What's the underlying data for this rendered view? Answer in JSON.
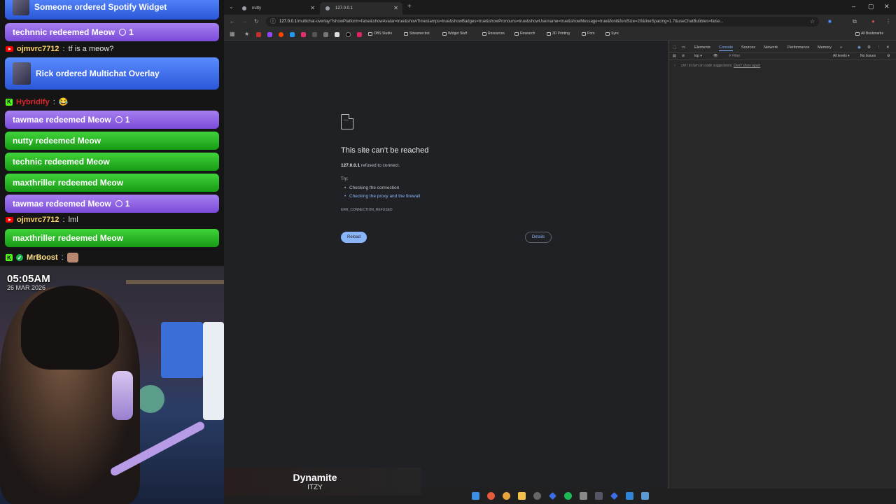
{
  "overlay": {
    "events": [
      {
        "type": "order",
        "text": "Someone ordered Spotify Widget"
      },
      {
        "type": "redeem",
        "user": "technnic",
        "action": "redeemed",
        "reward": "Meow",
        "count": "1"
      },
      {
        "type": "chat",
        "platform": "youtube",
        "user": "ojmvrc7712",
        "message": "tf is a meow?"
      },
      {
        "type": "order",
        "text": "Rick ordered Multichat Overlay"
      },
      {
        "type": "chat",
        "platform": "kick",
        "user": "Hybridlfy",
        "message": "😂"
      },
      {
        "type": "redeem",
        "user": "tawmae",
        "action": "redeemed",
        "reward": "Meow",
        "count": "1"
      },
      {
        "type": "redeem",
        "user": "nutty",
        "action": "redeemed",
        "reward": "Meow",
        "count": ""
      },
      {
        "type": "redeem",
        "user": "technic",
        "action": "redeemed",
        "reward": "Meow",
        "count": ""
      },
      {
        "type": "redeem",
        "user": "maxthriller",
        "action": "redeemed",
        "reward": "Meow",
        "count": ""
      },
      {
        "type": "redeem",
        "user": "tawmae",
        "action": "redeemed",
        "reward": "Meow",
        "count": "1"
      },
      {
        "type": "chat",
        "platform": "youtube",
        "user": "ojmvrc7712",
        "message": "lml"
      },
      {
        "type": "redeem",
        "user": "maxthriller",
        "action": "redeemed",
        "reward": "Meow",
        "count": ""
      },
      {
        "type": "chat",
        "platform": "kick",
        "user": "MrBoost",
        "message": ""
      }
    ],
    "clock": {
      "time": "05:05AM",
      "date": "26 MAR 2026"
    }
  },
  "browser": {
    "tabs": [
      {
        "label": "nutty",
        "active": false
      },
      {
        "label": "127.0.0.1",
        "active": true
      }
    ],
    "new_tab": "+",
    "url_host": "127.0.0.1",
    "url_path": "/multichat-overlay/?showPlatform=false&showAvatar=true&showTimestamps=true&showBadges=true&showPronouns=true&showUsername=true&showMessage=true&font&fontSize=20&lineSpacing=1.7&useChatBubbles=false...",
    "bookmarks": [
      "OBS Studio",
      "Streamer.bot",
      "Widget Stuff",
      "Resources",
      "Research",
      "3D Printing",
      "Porn",
      "Sync"
    ],
    "all_bookmarks": "All Bookmarks"
  },
  "error_page": {
    "title": "This site can’t be reached",
    "host": "127.0.0.1",
    "host_suffix": " refused to connect.",
    "try_label": "Try:",
    "suggestions": [
      "Checking the connection",
      "Checking the proxy and the firewall"
    ],
    "code": "ERR_CONNECTION_REFUSED",
    "reload_label": "Reload",
    "details_label": "Details"
  },
  "devtools": {
    "tabs": [
      "Elements",
      "Console",
      "Sources",
      "Network",
      "Performance",
      "Memory"
    ],
    "active_tab": "Console",
    "context": "top",
    "filter_placeholder": "Filter",
    "levels": "All levels",
    "issues": "No Issues",
    "hint": "ctrl I to turn on code suggestions.",
    "hint_link": "Don't show again"
  },
  "now_playing": {
    "title": "Dynamite",
    "artist": "ITZY"
  },
  "colors": {
    "accent": "#8ab4f8",
    "purple": "#8a5ae0",
    "green": "#22b51e",
    "blue": "#3d6cf0"
  }
}
